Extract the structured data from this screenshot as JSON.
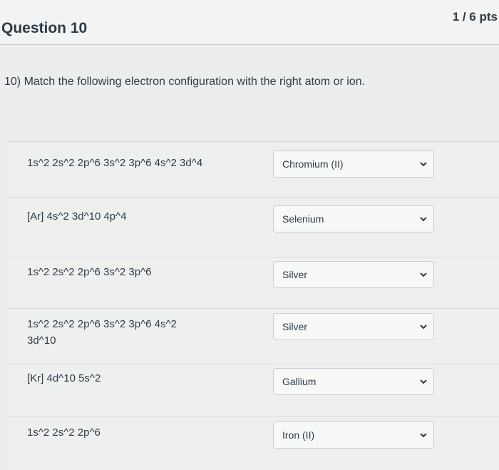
{
  "question": {
    "title": "Question 10",
    "points": "1 / 6 pts",
    "prompt": "10) Match the following electron configuration with the right atom or ion."
  },
  "matches": [
    {
      "label": "1s^2 2s^2 2p^6 3s^2 3p^6 4s^2 3d^4",
      "selected": "Chromium (II)"
    },
    {
      "label": "[Ar] 4s^2 3d^10 4p^4",
      "selected": "Selenium"
    },
    {
      "label": "1s^2 2s^2 2p^6 3s^2 3p^6",
      "selected": "Silver"
    },
    {
      "label": "1s^2 2s^2 2p^6 3s^2 3p^6 4s^2 3d^10",
      "selected": "Silver"
    },
    {
      "label": "[Kr] 4d^10 5s^2",
      "selected": "Gallium"
    },
    {
      "label": "1s^2 2s^2 2p^6",
      "selected": "Iron (II)"
    }
  ],
  "icons": {
    "dropdown": "chevron-down-icon"
  }
}
